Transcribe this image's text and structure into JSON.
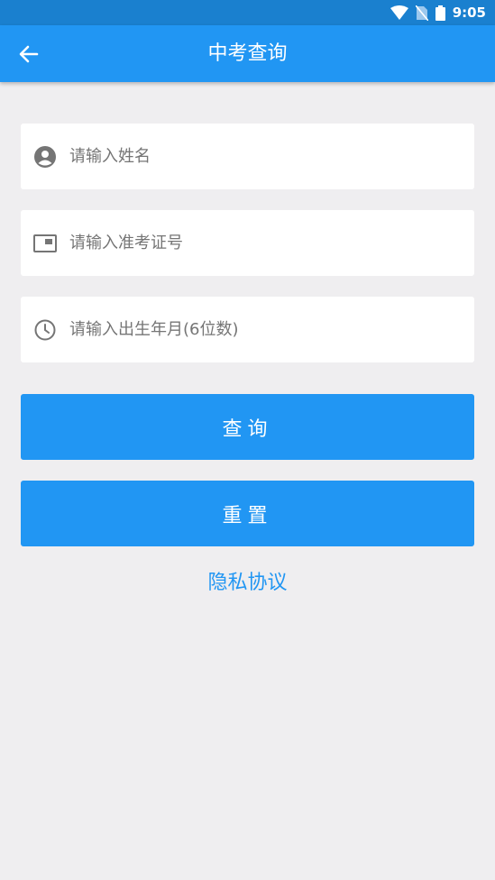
{
  "status_bar": {
    "time": "9:05"
  },
  "app_bar": {
    "title": "中考查询"
  },
  "form": {
    "name_placeholder": "请输入姓名",
    "exam_id_placeholder": "请输入准考证号",
    "birth_placeholder": "请输入出生年月(6位数)"
  },
  "buttons": {
    "query_label": "查询",
    "reset_label": "重置"
  },
  "links": {
    "privacy_label": "隐私协议"
  },
  "colors": {
    "primary": "#2196f3",
    "status_bar": "#1a80cf",
    "background": "#efeef0",
    "icon_gray": "#757575"
  }
}
